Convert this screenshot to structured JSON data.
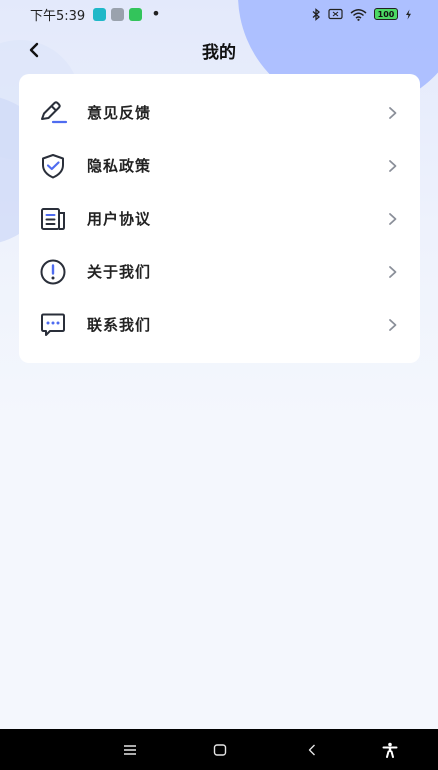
{
  "status_bar": {
    "time": "下午5:39",
    "app_icon_colors": [
      "#1fb8c8",
      "#9aa2ad",
      "#33c45b"
    ],
    "dot": "•",
    "battery_level": "100"
  },
  "header": {
    "title": "我的",
    "back_icon": "chevron-left-icon"
  },
  "menu": {
    "items": [
      {
        "label": "意见反馈",
        "icon": "pencil-edit-icon"
      },
      {
        "label": "隐私政策",
        "icon": "shield-check-icon"
      },
      {
        "label": "用户协议",
        "icon": "document-list-icon"
      },
      {
        "label": "关于我们",
        "icon": "info-exclamation-icon"
      },
      {
        "label": "联系我们",
        "icon": "chat-bubble-icon"
      }
    ]
  },
  "nav_bar": {
    "buttons": [
      "menu-icon",
      "home-square-icon",
      "back-triangle-icon",
      "accessibility-icon"
    ]
  },
  "colors": {
    "accent": "#4f6cf0",
    "icon_stroke": "#2a2f3a",
    "background": "#f4f7fd"
  }
}
